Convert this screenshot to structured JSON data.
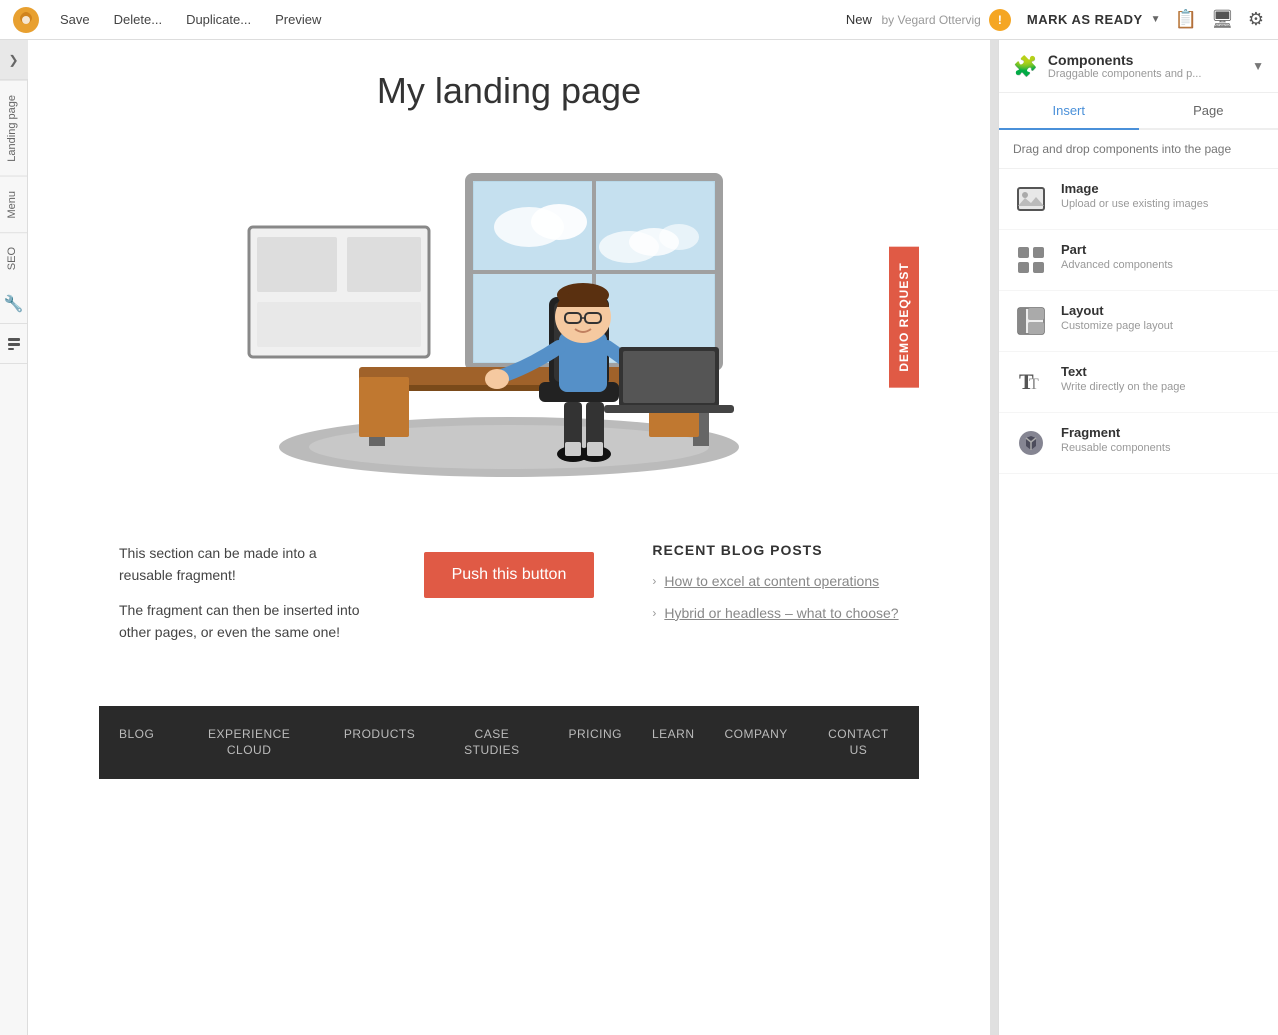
{
  "topbar": {
    "logo_alt": "Enonic logo",
    "save_label": "Save",
    "delete_label": "Delete...",
    "duplicate_label": "Duplicate...",
    "preview_label": "Preview",
    "doc_title": "New",
    "doc_author": "by Vegard Ottervig",
    "mark_ready_label": "MARK AS READY",
    "icons": {
      "clipboard": "📋",
      "monitor": "🖥",
      "gear": "⚙"
    }
  },
  "left_sidebar": {
    "toggle_icon": "❯",
    "items": [
      {
        "label": "Landing page",
        "type": "text"
      },
      {
        "label": "Menu",
        "type": "text"
      },
      {
        "label": "SEO",
        "type": "text"
      },
      {
        "label": "wrench",
        "type": "icon"
      },
      {
        "label": "layers",
        "type": "icon"
      }
    ]
  },
  "page": {
    "title": "My landing page",
    "demo_request_label": "DEMO REQUEST",
    "fragment_text_1": "This section can be made into a reusable fragment!",
    "fragment_text_2": "The fragment can then be inserted into other pages, or even the same one!",
    "push_button_label": "Push this button",
    "blog_posts": {
      "heading": "RECENT BLOG POSTS",
      "items": [
        {
          "title": "How to excel at content operations"
        },
        {
          "title": "Hybrid or headless – what to choose?"
        }
      ]
    },
    "footer_nav": [
      {
        "label": "BLOG"
      },
      {
        "label": "EXPERIENCE CLOUD"
      },
      {
        "label": "PRODUCTS"
      },
      {
        "label": "CASE STUDIES"
      },
      {
        "label": "PRICING"
      },
      {
        "label": "LEARN"
      },
      {
        "label": "COMPANY"
      },
      {
        "label": "CONTACT US"
      }
    ]
  },
  "right_panel": {
    "header": {
      "icon": "🧩",
      "title": "Components",
      "subtitle": "Draggable components and p...",
      "chevron": "▼"
    },
    "tabs": [
      {
        "label": "Insert",
        "active": true
      },
      {
        "label": "Page",
        "active": false
      }
    ],
    "drag_hint": "Drag and drop components into the page",
    "components": [
      {
        "name": "Image",
        "desc": "Upload or use existing images",
        "icon_type": "image"
      },
      {
        "name": "Part",
        "desc": "Advanced components",
        "icon_type": "puzzle"
      },
      {
        "name": "Layout",
        "desc": "Customize page layout",
        "icon_type": "layout"
      },
      {
        "name": "Text",
        "desc": "Write directly on the page",
        "icon_type": "text"
      },
      {
        "name": "Fragment",
        "desc": "Reusable components",
        "icon_type": "fragment"
      }
    ]
  },
  "colors": {
    "accent_red": "#e05a45",
    "accent_blue": "#4a90d9",
    "dark_footer": "#2a2a2a"
  }
}
